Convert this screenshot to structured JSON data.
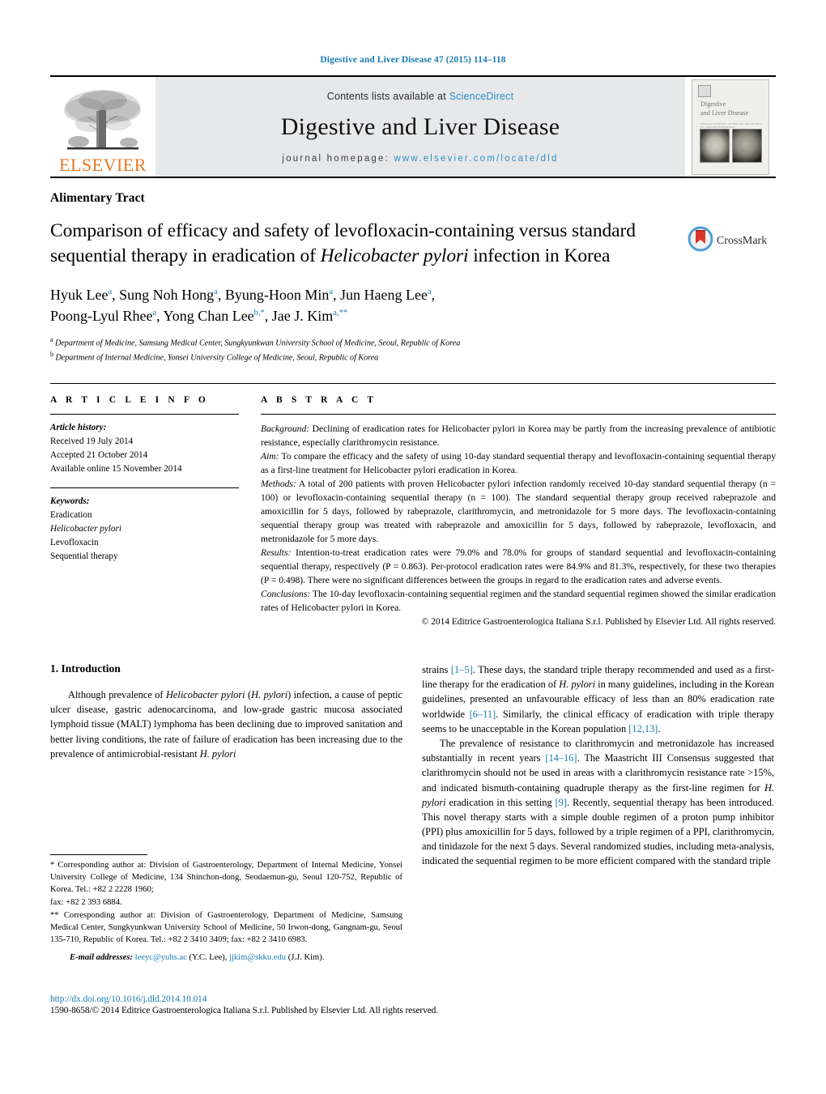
{
  "running_head": "Digestive and Liver Disease 47 (2015) 114–118",
  "masthead": {
    "publisher_name": "ELSEVIER",
    "contents_prefix": "Contents lists available at",
    "contents_link": "ScienceDirect",
    "journal_title": "Digestive and Liver Disease",
    "homepage_prefix": "journal homepage:",
    "homepage_url": "www.elsevier.com/locate/dld",
    "cover": {
      "title_line1": "Digestive",
      "title_line2": "and Liver Disease",
      "subtitle": "OFFICIAL JOURNAL OF THE ITALIAN SOCIETY OF GASTROENTEROLOGY"
    }
  },
  "article": {
    "section_label": "Alimentary Tract",
    "title_part1": "Comparison of efficacy and safety of levofloxacin-containing versus standard sequential therapy in eradication of ",
    "title_italic": "Helicobacter pylori",
    "title_part2": " infection in Korea",
    "crossmark_label": "CrossMark",
    "authors_line1": "Hyuk Lee",
    "authors_full": "Hyuk Lee a, Sung Noh Hong a, Byung-Hoon Min a, Jun Haeng Lee a, Poong-Lyul Rhee a, Yong Chan Lee b,*, Jae J. Kim a,**",
    "affiliation_a": "Department of Medicine, Samsung Medical Center, Sungkyunkwan University School of Medicine, Seoul, Republic of Korea",
    "affiliation_b": "Department of Internal Medicine, Yonsei University College of Medicine, Seoul, Republic of Korea"
  },
  "info": {
    "heading": "A R T I C L E    I N F O",
    "history_label": "Article history:",
    "received": "Received 19 July 2014",
    "accepted": "Accepted 21 October 2014",
    "available": "Available online 15 November 2014",
    "keywords_label": "Keywords:",
    "keywords": [
      "Eradication",
      "Helicobacter pylori",
      "Levofloxacin",
      "Sequential therapy"
    ]
  },
  "abstract": {
    "heading": "A B S T R A C T",
    "background_label": "Background:",
    "background_text": " Declining of eradication rates for Helicobacter pylori in Korea may be partly from the increasing prevalence of antibiotic resistance, especially clarithromycin resistance.",
    "aim_label": "Aim:",
    "aim_text": " To compare the efficacy and the safety of using 10-day standard sequential therapy and levofloxacin-containing sequential therapy as a first-line treatment for Helicobacter pylori eradication in Korea.",
    "methods_label": "Methods:",
    "methods_text": " A total of 200 patients with proven Helicobacter pylori infection randomly received 10-day standard sequential therapy (n = 100) or levofloxacin-containing sequential therapy (n = 100). The standard sequential therapy group received rabeprazole and amoxicillin for 5 days, followed by rabeprazole, clarithromycin, and metronidazole for 5 more days. The levofloxacin-containing sequential therapy group was treated with rabeprazole and amoxicillin for 5 days, followed by rabeprazole, levofloxacin, and metronidazole for 5 more days.",
    "results_label": "Results:",
    "results_text": " Intention-to-treat eradication rates were 79.0% and 78.0% for groups of standard sequential and levofloxacin-containing sequential therapy, respectively (P = 0.863). Per-protocol eradication rates were 84.9% and 81.3%, respectively, for these two therapies (P = 0.498). There were no significant differences between the groups in regard to the eradication rates and adverse events.",
    "conclusions_label": "Conclusions:",
    "conclusions_text": " The 10-day levofloxacin-containing sequential regimen and the standard sequential regimen showed the similar eradication rates of Helicobacter pylori in Korea.",
    "copyright": "© 2014 Editrice Gastroenterologica Italiana S.r.l. Published by Elsevier Ltd. All rights reserved."
  },
  "body": {
    "intro_heading": "1. Introduction",
    "intro_p1": "Although prevalence of Helicobacter pylori (H. pylori) infection, a cause of peptic ulcer disease, gastric adenocarcinoma, and low-grade gastric mucosa associated lymphoid tissue (MALT) lymphoma has been declining due to improved sanitation and better living conditions, the rate of failure of eradication has been increasing due to the prevalence of antimicrobial-resistant H. pylori strains [1–5]. These days, the standard triple therapy recommended and used as a first-line therapy for the eradication of H. pylori in many guidelines, including in the Korean guidelines, presented an unfavourable efficacy of less than an 80% eradication rate worldwide [6–11]. Similarly, the clinical efficacy of eradication with triple therapy seems to be unacceptable in the Korean population [12,13].",
    "intro_p2": "The prevalence of resistance to clarithromycin and metronidazole has increased substantially in recent years [14–16]. The Maastricht III Consensus suggested that clarithromycin should not be used in areas with a clarithromycin resistance rate >15%, and indicated bismuth-containing quadruple therapy as the first-line regimen for H. pylori eradication in this setting [9]. Recently, sequential therapy has been introduced. This novel therapy starts with a simple double regimen of a proton pump inhibitor (PPI) plus amoxicillin for 5 days, followed by a triple regimen of a PPI, clarithromycin, and tinidazole for the next 5 days. Several randomized studies, including meta-analysis, indicated the sequential regimen to be more efficient compared with the standard triple"
  },
  "footnotes": {
    "fn1": "* Corresponding author at: Division of Gastroenterology, Department of Internal Medicine, Yonsei University College of Medicine, 134 Shinchon-dong, Seodaemun-gu, Seoul 120-752, Republic of Korea. Tel.: +82 2 2228 1960;",
    "fn1b": "fax: +82 2 393 6884.",
    "fn2": "** Corresponding author at: Division of Gastroenterology, Department of Medicine, Samsung Medical Center, Sungkyunkwan University School of Medicine, 50 Irwon-dong, Gangnam-gu, Seoul 135-710, Republic of Korea. Tel.: +82 2 3410 3409; fax: +82 2 3410 6983.",
    "email_label": "E-mail addresses:",
    "email1": "leeyc@yuhs.ac",
    "email1_owner": "(Y.C. Lee),",
    "email2": "jjkim@skku.edu",
    "email2_owner": "(J.J. Kim)."
  },
  "bottom": {
    "doi": "http://dx.doi.org/10.1016/j.dld.2014.10.014",
    "issn_line": "1590-8658/© 2014 Editrice Gastroenterologica Italiana S.r.l. Published by Elsevier Ltd. All rights reserved."
  },
  "colors": {
    "link": "#1a7bb0",
    "elsevier_orange": "#E87722",
    "band_gray": "#e7e8ea"
  }
}
